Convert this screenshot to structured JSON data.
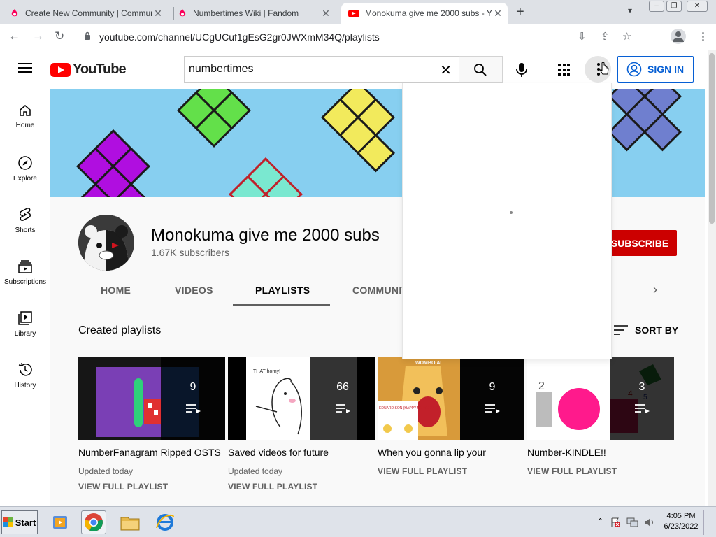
{
  "browser": {
    "tabs": [
      {
        "title": "Create New Community | Communi",
        "icon": "fandom-icon"
      },
      {
        "title": "Numbertimes Wiki | Fandom",
        "icon": "fandom-icon"
      },
      {
        "title": "Monokuma give me 2000 subs - Yo",
        "icon": "youtube-icon",
        "active": true
      }
    ],
    "url": "youtube.com/channel/UCgUCuf1gEsG2gr0JWXmM34Q/playlists"
  },
  "youtube": {
    "logo_text": "YouTube",
    "search_value": "numbertimes",
    "signin_label": "SIGN IN",
    "sidebar": [
      {
        "label": "Home",
        "icon": "home-icon"
      },
      {
        "label": "Explore",
        "icon": "compass-icon"
      },
      {
        "label": "Shorts",
        "icon": "shorts-icon"
      },
      {
        "label": "Subscriptions",
        "icon": "subscriptions-icon"
      },
      {
        "label": "Library",
        "icon": "library-icon"
      },
      {
        "label": "History",
        "icon": "history-icon"
      }
    ],
    "channel": {
      "name": "Monokuma give me 2000 subs",
      "subscribers": "1.67K subscribers",
      "subscribe_label": "SUBSCRIBE"
    },
    "tabs": [
      "HOME",
      "VIDEOS",
      "PLAYLISTS",
      "COMMUNITY"
    ],
    "active_tab": "PLAYLISTS",
    "section_title": "Created playlists",
    "sort_label": "SORT BY",
    "playlists": [
      {
        "title": "NumberFanagram Ripped OSTS",
        "count": "9",
        "updated": "Updated today",
        "view": "VIEW FULL PLAYLIST"
      },
      {
        "title": "Saved videos for future",
        "count": "66",
        "updated": "Updated today",
        "view": "VIEW FULL PLAYLIST"
      },
      {
        "title": "When you gonna lip your",
        "count": "9",
        "updated": "",
        "view": "VIEW FULL PLAYLIST"
      },
      {
        "title": "Number-KINDLE!!",
        "count": "3",
        "updated": "",
        "view": "VIEW FULL PLAYLIST"
      }
    ],
    "thumb_text": {
      "saved": "THAT horny!",
      "wombo": "WOMBO.AI",
      "eduard": "EDUARD SON (HAPPY MOM'S DAY)",
      "numbers": [
        "2",
        "4",
        "5"
      ]
    }
  },
  "taskbar": {
    "start_label": "Start",
    "time": "4:05 PM",
    "date": "6/23/2022"
  },
  "colors": {
    "youtube_red": "#ff0000",
    "subscribe_red": "#cc0000",
    "link_blue": "#065fd4"
  }
}
